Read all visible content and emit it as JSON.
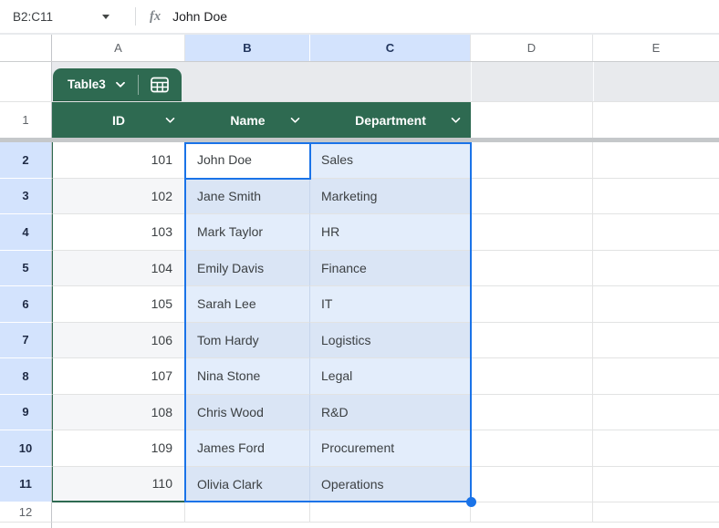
{
  "formula_bar": {
    "name_box": "B2:C11",
    "fx_label": "fx",
    "value": "John Doe"
  },
  "column_headers": [
    {
      "label": "A",
      "selected": false
    },
    {
      "label": "B",
      "selected": true
    },
    {
      "label": "C",
      "selected": true
    },
    {
      "label": "D",
      "selected": false
    },
    {
      "label": "E",
      "selected": false
    }
  ],
  "table": {
    "name": "Table3",
    "header_row_num": "1",
    "columns": [
      {
        "label": "ID"
      },
      {
        "label": "Name"
      },
      {
        "label": "Department"
      }
    ],
    "rows": [
      {
        "n": "2",
        "id": "101",
        "name": "John Doe",
        "dept": "Sales"
      },
      {
        "n": "3",
        "id": "102",
        "name": "Jane Smith",
        "dept": "Marketing"
      },
      {
        "n": "4",
        "id": "103",
        "name": "Mark Taylor",
        "dept": "HR"
      },
      {
        "n": "5",
        "id": "104",
        "name": "Emily Davis",
        "dept": "Finance"
      },
      {
        "n": "6",
        "id": "105",
        "name": "Sarah Lee",
        "dept": "IT"
      },
      {
        "n": "7",
        "id": "106",
        "name": "Tom Hardy",
        "dept": "Logistics"
      },
      {
        "n": "8",
        "id": "107",
        "name": "Nina Stone",
        "dept": "Legal"
      },
      {
        "n": "9",
        "id": "108",
        "name": "Chris Wood",
        "dept": "R&D"
      },
      {
        "n": "10",
        "id": "109",
        "name": "James Ford",
        "dept": "Procurement"
      },
      {
        "n": "11",
        "id": "110",
        "name": "Olivia Clark",
        "dept": "Operations"
      }
    ]
  },
  "rows_after": {
    "first_empty_row_num": "12"
  },
  "selection": {
    "range": "B2:C11",
    "active_cell": "B2"
  },
  "colors": {
    "green": "#2e6a51",
    "blue": "#1a73e8",
    "selheader": "#d3e3fd",
    "selfill": "#e3edfb",
    "selfillband": "#dae5f5",
    "bandgray": "#f5f6f8",
    "abovegrid": "#e8eaed",
    "divider": "#c5c8ca"
  }
}
